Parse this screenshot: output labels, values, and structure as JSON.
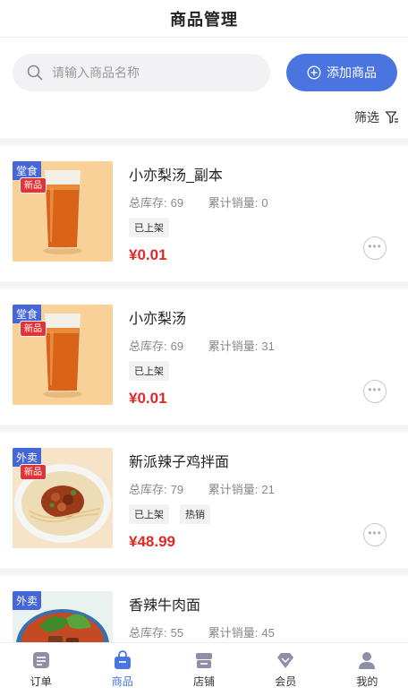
{
  "header": {
    "title": "商品管理"
  },
  "search": {
    "placeholder": "请输入商品名称",
    "add_label": "添加商品"
  },
  "filter": {
    "label": "筛选"
  },
  "colors": {
    "accent": "#4a74e0",
    "price": "#e02828",
    "corner_tag": "#4466d8"
  },
  "products": [
    {
      "corner_tag": "堂食",
      "new_badge": "新品",
      "name": "小亦梨汤_副本",
      "stock_label": "总库存:",
      "stock": "69",
      "sales_label": "累计销量:",
      "sales": "0",
      "badges": [
        "已上架"
      ],
      "price": "¥0.01",
      "image": "tea-glass"
    },
    {
      "corner_tag": "堂食",
      "new_badge": "新品",
      "name": "小亦梨汤",
      "stock_label": "总库存:",
      "stock": "69",
      "sales_label": "累计销量:",
      "sales": "31",
      "badges": [
        "已上架"
      ],
      "price": "¥0.01",
      "image": "tea-glass"
    },
    {
      "corner_tag": "外卖",
      "new_badge": "新品",
      "name": "新派辣子鸡拌面",
      "stock_label": "总库存:",
      "stock": "79",
      "sales_label": "累计销量:",
      "sales": "21",
      "badges": [
        "已上架",
        "热销"
      ],
      "price": "¥48.99",
      "image": "noodle-plate"
    },
    {
      "corner_tag": "外卖",
      "name": "香辣牛肉面",
      "stock_label": "总库存:",
      "stock": "55",
      "sales_label": "累计销量:",
      "sales": "45",
      "image": "noodle-bowl"
    }
  ],
  "tabbar": {
    "items": [
      {
        "label": "订单",
        "icon": "order-icon"
      },
      {
        "label": "商品",
        "icon": "bag-icon",
        "active": true
      },
      {
        "label": "店铺",
        "icon": "shop-icon"
      },
      {
        "label": "会员",
        "icon": "diamond-icon"
      },
      {
        "label": "我的",
        "icon": "user-icon"
      }
    ]
  }
}
